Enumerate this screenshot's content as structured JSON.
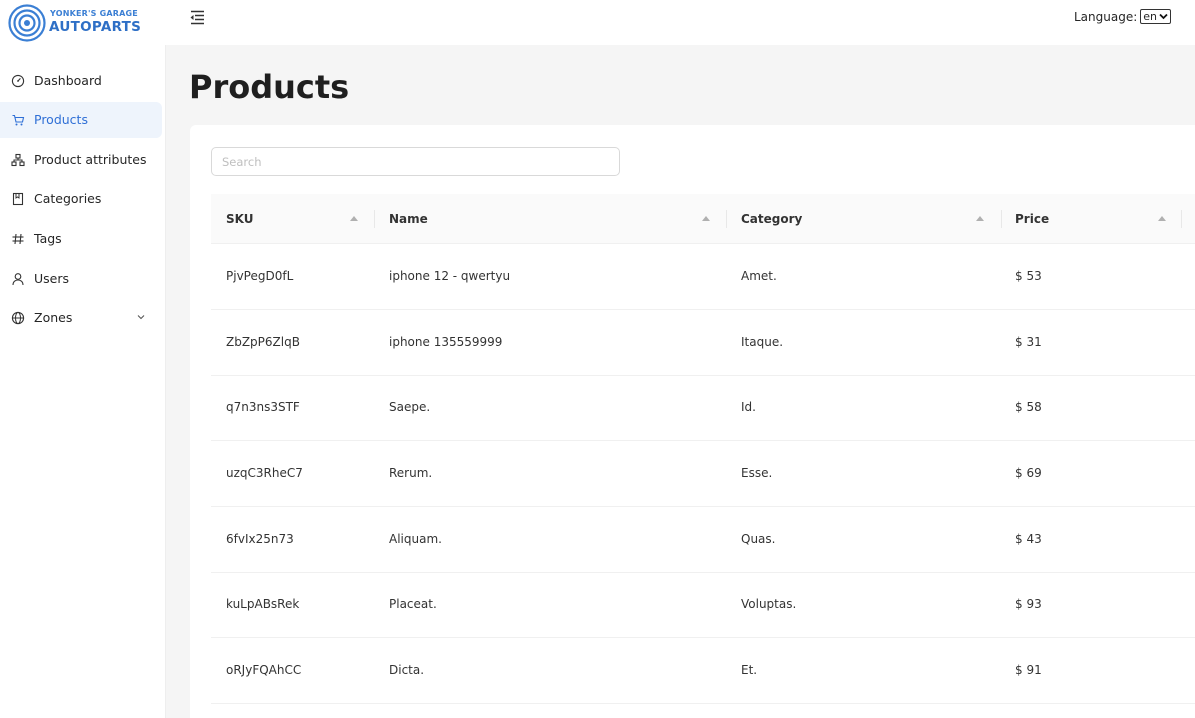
{
  "brand": {
    "top": "YONKER'S GARAGE",
    "bottom": "AUTOPARTS"
  },
  "language": {
    "label": "Language:",
    "value": "en"
  },
  "sidebar": {
    "items": [
      {
        "label": "Dashboard",
        "icon": "dashboard-icon",
        "active": false
      },
      {
        "label": "Products",
        "icon": "cart-icon",
        "active": true
      },
      {
        "label": "Product attributes",
        "icon": "hierarchy-icon",
        "active": false
      },
      {
        "label": "Categories",
        "icon": "book-icon",
        "active": false
      },
      {
        "label": "Tags",
        "icon": "hash-icon",
        "active": false
      },
      {
        "label": "Users",
        "icon": "user-icon",
        "active": false
      },
      {
        "label": "Zones",
        "icon": "globe-icon",
        "active": false,
        "expandable": true
      }
    ]
  },
  "main": {
    "title": "Products",
    "search_placeholder": "Search",
    "columns": [
      "SKU",
      "Name",
      "Category",
      "Price"
    ],
    "rows": [
      {
        "sku": "PjvPegD0fL",
        "name": "iphone 12 - qwertyu",
        "category": "Amet.",
        "price": "$ 53"
      },
      {
        "sku": "ZbZpP6ZlqB",
        "name": "iphone 135559999",
        "category": "Itaque.",
        "price": "$ 31"
      },
      {
        "sku": "q7n3ns3STF",
        "name": "Saepe.",
        "category": "Id.",
        "price": "$ 58"
      },
      {
        "sku": "uzqC3RheC7",
        "name": "Rerum.",
        "category": "Esse.",
        "price": "$ 69"
      },
      {
        "sku": "6fvIx25n73",
        "name": "Aliquam.",
        "category": "Quas.",
        "price": "$ 43"
      },
      {
        "sku": "kuLpABsRek",
        "name": "Placeat.",
        "category": "Voluptas.",
        "price": "$ 93"
      },
      {
        "sku": "oRJyFQAhCC",
        "name": "Dicta.",
        "category": "Et.",
        "price": "$ 91"
      }
    ]
  },
  "colors": {
    "accent": "#2f6fd6",
    "active_bg": "#eef4fc",
    "page_bg": "#f5f5f5"
  }
}
